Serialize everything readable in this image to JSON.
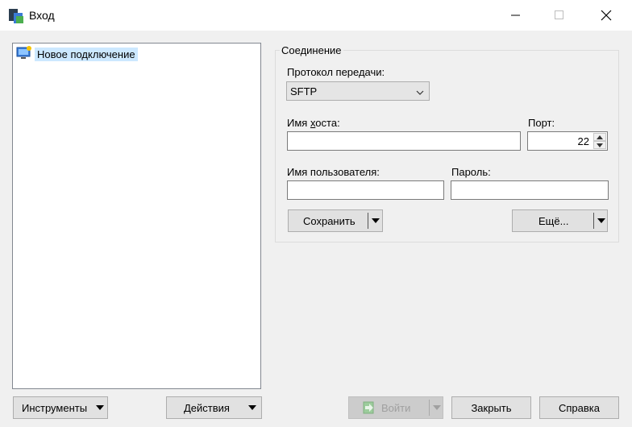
{
  "window": {
    "title": "Вход"
  },
  "tree": {
    "items": [
      {
        "label": "Новое подключение"
      }
    ]
  },
  "connection": {
    "group_title": "Соединение",
    "protocol_label": "Протокол передачи:",
    "protocol_value": "SFTP",
    "host_label": "Имя хоста:",
    "host_value": "",
    "port_label": "Порт:",
    "port_value": "22",
    "user_label": "Имя пользователя:",
    "user_value": "",
    "password_label": "Пароль:",
    "password_value": "",
    "save_label": "Сохранить",
    "more_label": "Ещё..."
  },
  "footer": {
    "tools_label": "Инструменты",
    "actions_label": "Действия",
    "login_label": "Войти",
    "close_label": "Закрыть",
    "help_label": "Справка"
  }
}
